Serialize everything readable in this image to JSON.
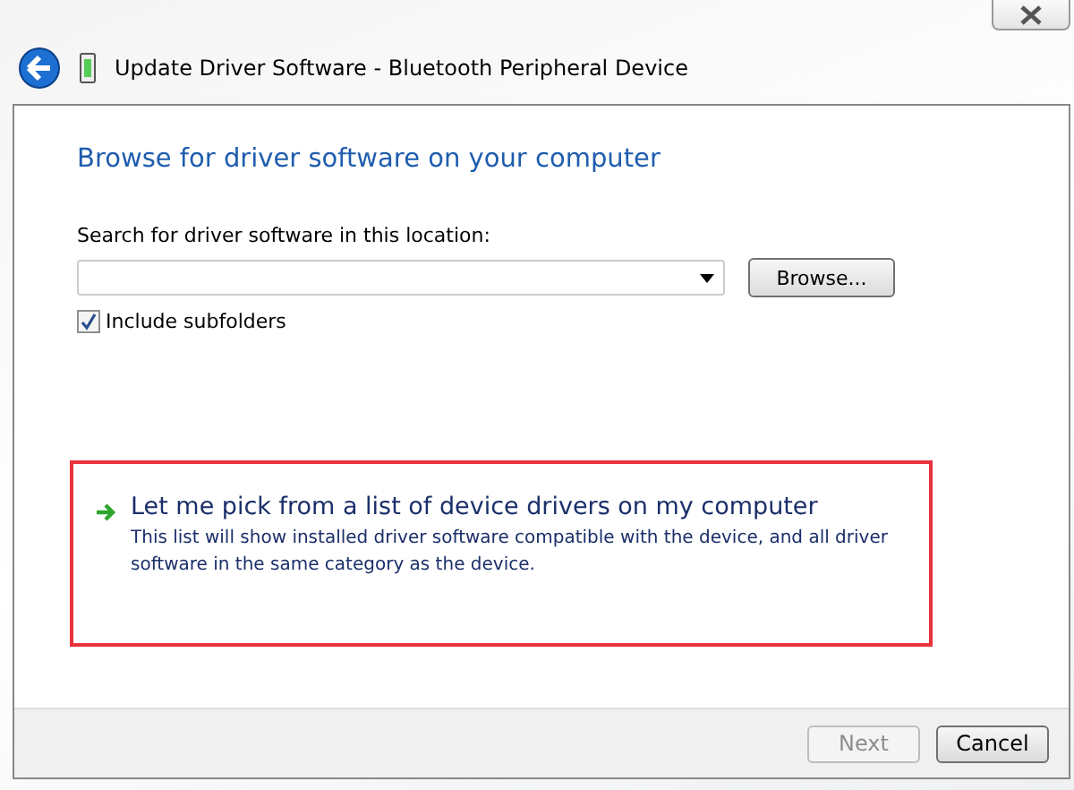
{
  "window": {
    "title": "Update Driver Software - Bluetooth Peripheral Device"
  },
  "heading": "Browse for driver software on your computer",
  "search": {
    "label": "Search for driver software in this location:",
    "browse_button": "Browse..."
  },
  "include_subfolders": {
    "label": "Include subfolders",
    "checked": true
  },
  "option": {
    "title": "Let me pick from a list of device drivers on my computer",
    "description": "This list will show installed driver software compatible with the device, and all driver software in the same category as the device.",
    "highlighted": true
  },
  "buttons": [
    {
      "label": "Next",
      "disabled": true
    },
    {
      "label": "Cancel",
      "disabled": false
    }
  ]
}
